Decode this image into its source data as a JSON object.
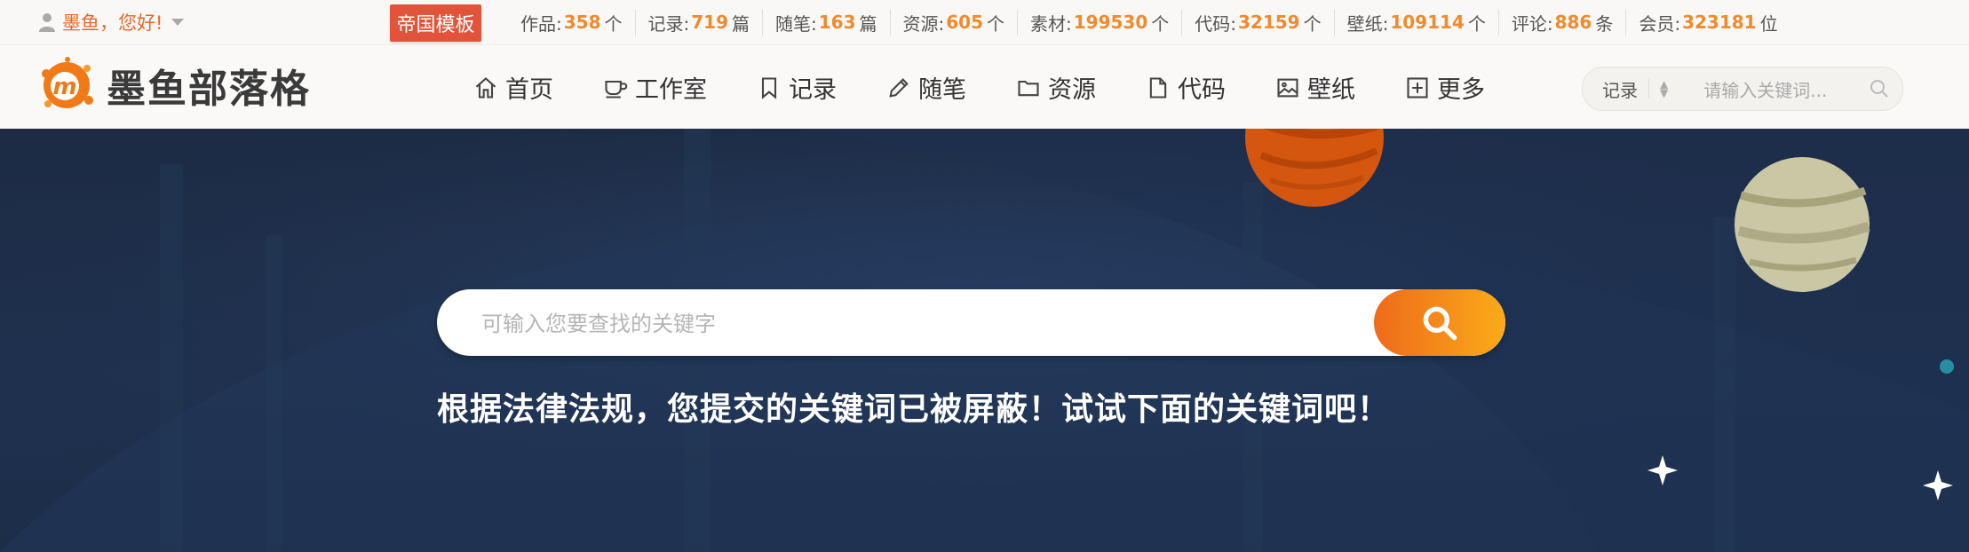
{
  "topbar": {
    "user_greeting": "墨鱼，您好!",
    "badge": "帝国模板",
    "stats": [
      {
        "label": "作品:",
        "value": "358",
        "unit": "个"
      },
      {
        "label": "记录:",
        "value": "719",
        "unit": "篇"
      },
      {
        "label": "随笔:",
        "value": "163",
        "unit": "篇"
      },
      {
        "label": "资源:",
        "value": "605",
        "unit": "个"
      },
      {
        "label": "素材:",
        "value": "199530",
        "unit": "个"
      },
      {
        "label": "代码:",
        "value": "32159",
        "unit": "个"
      },
      {
        "label": "壁纸:",
        "value": "109114",
        "unit": "个"
      },
      {
        "label": "评论:",
        "value": "886",
        "unit": "条"
      },
      {
        "label": "会员:",
        "value": "323181",
        "unit": "位"
      }
    ]
  },
  "nav": {
    "logo_text": "墨鱼部落格",
    "items": [
      {
        "label": "首页",
        "icon": "home-icon"
      },
      {
        "label": "工作室",
        "icon": "cup-icon"
      },
      {
        "label": "记录",
        "icon": "bookmark-icon"
      },
      {
        "label": "随笔",
        "icon": "pencil-icon"
      },
      {
        "label": "资源",
        "icon": "folder-icon"
      },
      {
        "label": "代码",
        "icon": "file-icon"
      },
      {
        "label": "壁纸",
        "icon": "image-icon"
      },
      {
        "label": "更多",
        "icon": "plus-square-icon"
      }
    ],
    "search": {
      "category": "记录",
      "placeholder": "请输入关键词..."
    }
  },
  "hero": {
    "search_placeholder": "可输入您要查找的关键字",
    "notice": "根据法律法规，您提交的关键词已被屏蔽！试试下面的关键词吧！"
  },
  "colors": {
    "accent": "#f08a2c",
    "badge": "#e2533b",
    "hero_bg": "#1d2b44",
    "button_gradient": [
      "#ee6a1a",
      "#fbab19"
    ]
  }
}
